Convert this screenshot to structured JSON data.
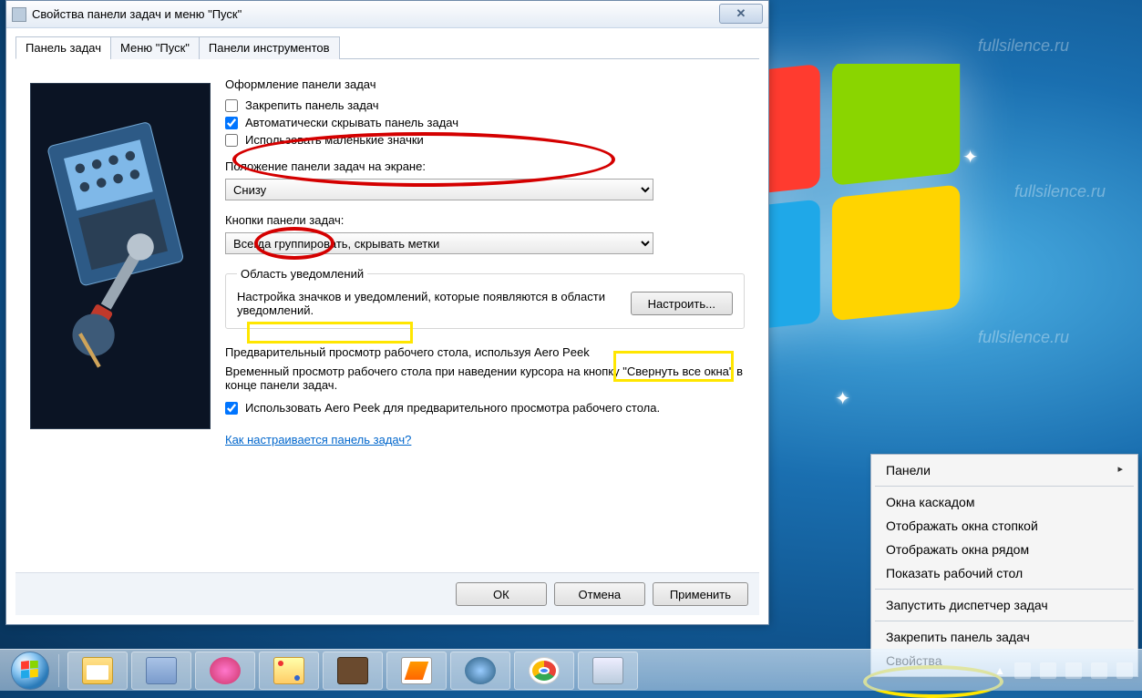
{
  "watermark": "fullsilence.ru",
  "dialog": {
    "title": "Свойства панели задач и меню \"Пуск\"",
    "tabs": [
      "Панель задач",
      "Меню \"Пуск\"",
      "Панели инструментов"
    ],
    "active_tab": 0,
    "appearance": {
      "heading": "Оформление панели задач",
      "lock": {
        "label": "Закрепить панель задач",
        "checked": false
      },
      "autohide": {
        "label": "Автоматически скрывать панель задач",
        "checked": true
      },
      "small_icons": {
        "label": "Использовать маленькие значки",
        "checked": false
      }
    },
    "position": {
      "label": "Положение панели задач на экране:",
      "value": "Снизу"
    },
    "buttons_combine": {
      "label": "Кнопки панели задач:",
      "value": "Всегда группировать, скрывать метки"
    },
    "notification_area": {
      "legend": "Область уведомлений",
      "text": "Настройка значков и уведомлений, которые появляются в области уведомлений.",
      "button": "Настроить..."
    },
    "aero_peek": {
      "heading": "Предварительный просмотр рабочего стола, используя Aero Peek",
      "desc": "Временный просмотр рабочего стола при наведении курсора на кнопку \"Свернуть все окна\" в конце панели задач.",
      "checkbox": {
        "label": "Использовать Aero Peek для предварительного просмотра рабочего стола.",
        "checked": true
      }
    },
    "help_link": "Как настраивается панель задач?",
    "ok": "ОК",
    "cancel": "Отмена",
    "apply": "Применить"
  },
  "context_menu": {
    "items": [
      {
        "label": "Панели",
        "type": "submenu"
      },
      {
        "type": "sep"
      },
      {
        "label": "Окна каскадом"
      },
      {
        "label": "Отображать окна стопкой"
      },
      {
        "label": "Отображать окна рядом"
      },
      {
        "label": "Показать рабочий стол"
      },
      {
        "type": "sep"
      },
      {
        "label": "Запустить диспетчер задач"
      },
      {
        "type": "sep"
      },
      {
        "label": "Закрепить панель задач"
      },
      {
        "label": "Свойства"
      }
    ]
  },
  "taskbar_apps": [
    "file-explorer",
    "virtualbox",
    "scissors-tool",
    "mspaint",
    "minecraft",
    "notepadpp",
    "thunderbird",
    "chrome",
    "system-settings"
  ],
  "icon_classes": [
    "i-exp",
    "i-vbox",
    "i-sci",
    "i-paint",
    "i-mc",
    "i-np",
    "i-tb",
    "i-ch",
    "i-sys"
  ]
}
